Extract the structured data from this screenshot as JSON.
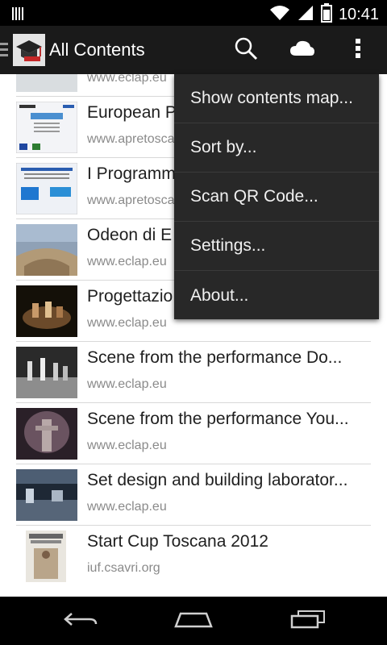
{
  "status": {
    "time": "10:41"
  },
  "action_bar": {
    "title": "All Contents",
    "icons": [
      "search-icon",
      "cloud-icon",
      "overflow-menu-icon"
    ]
  },
  "items": [
    {
      "title": "",
      "subtitle": "www.eclap.eu",
      "thumb_color": "#9a9fa6"
    },
    {
      "title": "European P",
      "subtitle": "www.apretosca",
      "thumb_color": "#f3f4f7"
    },
    {
      "title": "I Programm",
      "subtitle": "www.apretosca",
      "thumb_color": "#eef1f6"
    },
    {
      "title": "Odeon di E",
      "subtitle": "www.eclap.eu",
      "thumb_color": "#8fa1b6"
    },
    {
      "title": "Progettazio",
      "subtitle": "www.eclap.eu",
      "thumb_color": "#3c2a1f"
    },
    {
      "title": "Scene from the performance Do...",
      "subtitle": "www.eclap.eu",
      "thumb_color": "#6f6f6f"
    },
    {
      "title": "Scene from the performance You...",
      "subtitle": "www.eclap.eu",
      "thumb_color": "#4b3b44"
    },
    {
      "title": "Set design and building laborator...",
      "subtitle": "www.eclap.eu",
      "thumb_color": "#3d4a5c"
    },
    {
      "title": "Start Cup Toscana 2012",
      "subtitle": "iuf.csavri.org",
      "thumb_color": "#e9e6df"
    }
  ],
  "menu": {
    "items": [
      "Show contents map...",
      "Sort by...",
      "Scan QR Code...",
      "Settings...",
      "About..."
    ]
  },
  "nav": {
    "icons": [
      "back-icon",
      "home-icon",
      "recent-apps-icon"
    ]
  }
}
